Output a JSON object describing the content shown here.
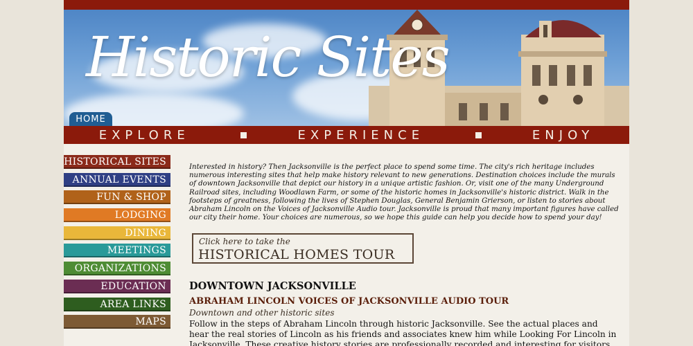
{
  "header": {
    "site_title": "Historic Sites",
    "home_tab": "HOME",
    "tagline_words": [
      "EXPLORE",
      "EXPERIENCE",
      "ENJOY"
    ]
  },
  "nav": {
    "items": [
      {
        "label": "HISTORICAL SITES",
        "color": "#8b2a1a"
      },
      {
        "label": "ANNUAL EVENTS",
        "color": "#2f3f84"
      },
      {
        "label": "FUN & SHOP",
        "color": "#b0621a"
      },
      {
        "label": "LODGING",
        "color": "#e07a24"
      },
      {
        "label": "DINING",
        "color": "#e9b73a"
      },
      {
        "label": "MEETINGS",
        "color": "#2a9a99"
      },
      {
        "label": "ORGANIZATIONS",
        "color": "#4e8c34"
      },
      {
        "label": "EDUCATION",
        "color": "#6b2d53"
      },
      {
        "label": "AREA LINKS",
        "color": "#2e5d1f"
      },
      {
        "label": "MAPS",
        "color": "#7d5a34"
      }
    ]
  },
  "main": {
    "intro": "Interested in history? Then Jacksonville is the perfect place to spend some time. The city's rich heritage includes numerous interesting sites that help make history relevant to new generations. Destination choices include the murals of downtown Jacksonville that depict our history in a unique artistic fashion. Or, visit one of the many Underground Railroad sites, including Woodlawn Farm, or some of the historic homes in Jacksonville's historic district.  Walk in the footsteps of greatness, following the lives of Stephen Douglas, General Benjamin Grierson, or listen to stories about Abraham Lincoln on the Voices of Jacksonville Audio tour.  Jacksonville is proud that many important figures have called our city their home. Your choices are numerous, so we hope this guide can help you decide how to spend your day!",
    "tour_button": {
      "line1": "Click here to take the",
      "line2": "HISTORICAL HOMES TOUR"
    },
    "section_heading": "DOWNTOWN JACKSONVILLE",
    "subheading": "ABRAHAM LINCOLN VOICES OF JACKSONVILLE AUDIO TOUR",
    "subcaption": "Downtown and other historic sites",
    "body": "Follow in the steps of Abraham Lincoln through historic Jacksonville.  See the actual places and hear the real stories of Lincoln as his friends and associates knew him while Looking For Lincoln in Jacksonville.  These creative history stories are professionally recorded and interesting for visitors of"
  },
  "colors": {
    "brand_red": "#8b1a0b",
    "home_tab_blue": "#1f5d93",
    "content_bg": "#f3f0e9"
  }
}
